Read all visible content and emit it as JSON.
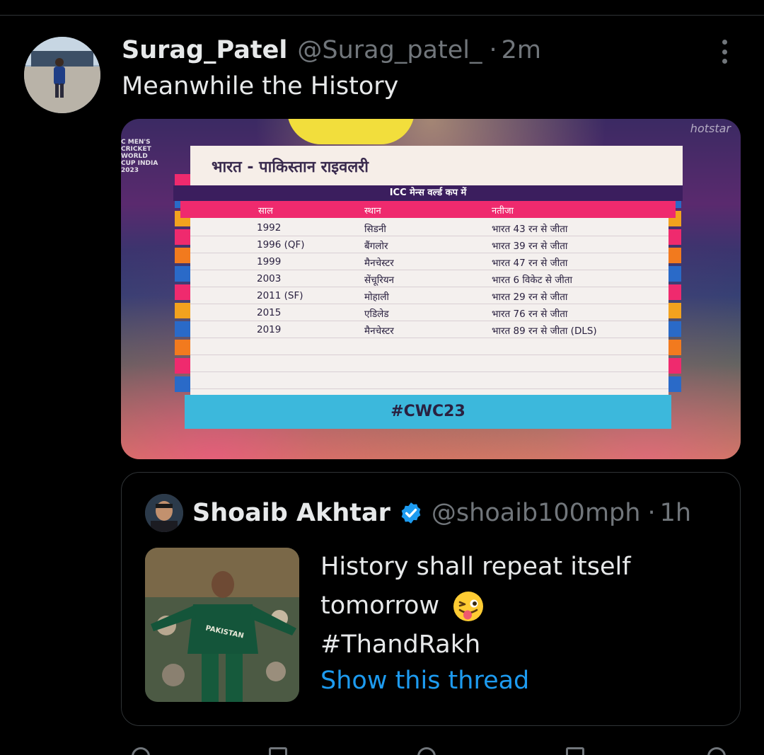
{
  "tweet": {
    "author_name": "Surag_Patel",
    "author_handle": "@Surag_patel_",
    "separator": "·",
    "time": "2m",
    "text": "Meanwhile the History"
  },
  "media": {
    "watermark": "hotstar",
    "event_logo": "C MEN'S CRICKET WORLD CUP INDIA 2023",
    "board": {
      "title": "भारत - पाकिस्तान राइवलरी",
      "subtitle": "ICC मेन्स वर्ल्ड कप में",
      "columns": [
        "साल",
        "स्थान",
        "नतीजा"
      ],
      "rows": [
        {
          "year": "1992",
          "venue": "सिडनी",
          "result": "भारत 43 रन से जीता"
        },
        {
          "year": "1996 (QF)",
          "venue": "बैंगलोर",
          "result": "भारत 39 रन से जीता"
        },
        {
          "year": "1999",
          "venue": "मैनचेस्टर",
          "result": "भारत 47 रन से जीता"
        },
        {
          "year": "2003",
          "venue": "सेंचूरियन",
          "result": "भारत 6 विकेट से जीता"
        },
        {
          "year": "2011 (SF)",
          "venue": "मोहाली",
          "result": "भारत 29 रन से जीता"
        },
        {
          "year": "2015",
          "venue": "एडिलेड",
          "result": "भारत 76 रन से जीता"
        },
        {
          "year": "2019",
          "venue": "मैनचेस्टर",
          "result": "भारत 89 रन से जीता (DLS)"
        }
      ],
      "footer": "#CWC23"
    },
    "colors": {
      "board_pink": "#ef2a6e",
      "board_purple": "#3b1e5e",
      "board_cyan": "#3cb8dc"
    }
  },
  "quote": {
    "author_name": "Shoaib Akhtar",
    "author_handle": "@shoaib100mph",
    "separator": "·",
    "time": "1h",
    "verified_icon": "verified-badge-icon",
    "text_lines": [
      "History shall repeat itself",
      "tomorrow",
      "#ThandRakh"
    ],
    "emoji": "winking-face-with-tongue-icon",
    "thumb_jersey_text": "PAKISTAN",
    "show_thread": "Show this thread"
  },
  "icons": {
    "more": "more-options-icon"
  },
  "colors": {
    "background": "#000000",
    "text": "#e7e9ea",
    "muted": "#71767b",
    "link": "#1d9bf0",
    "border": "#2f3336"
  }
}
